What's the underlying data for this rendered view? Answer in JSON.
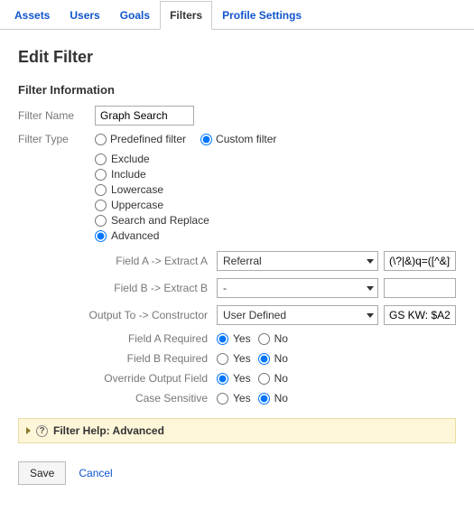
{
  "tabs": {
    "items": [
      "Assets",
      "Users",
      "Goals",
      "Filters",
      "Profile Settings"
    ],
    "active_index": 3
  },
  "page_title": "Edit Filter",
  "section_title": "Filter Information",
  "labels": {
    "filter_name": "Filter Name",
    "filter_type": "Filter Type"
  },
  "filter_name_value": "Graph Search",
  "filter_type": {
    "predefined": "Predefined filter",
    "custom": "Custom filter",
    "selected": "custom"
  },
  "custom_options": {
    "items": [
      "Exclude",
      "Include",
      "Lowercase",
      "Uppercase",
      "Search and Replace",
      "Advanced"
    ],
    "selected_index": 5
  },
  "advanced": {
    "field_a_label": "Field A -> Extract A",
    "field_a_select": "Referral",
    "field_a_value": "(\\?|&)q=([^&]*)",
    "field_b_label": "Field B -> Extract B",
    "field_b_select": "-",
    "field_b_value": "",
    "output_label": "Output To -> Constructor",
    "output_select": "User Defined",
    "output_value": "GS KW: $A2",
    "field_a_required_label": "Field A Required",
    "field_b_required_label": "Field B Required",
    "override_label": "Override Output Field",
    "case_label": "Case Sensitive",
    "yes": "Yes",
    "no": "No",
    "field_a_required": "yes",
    "field_b_required": "no",
    "override": "yes",
    "case_sensitive": "no"
  },
  "help_title": "Filter Help: Advanced",
  "actions": {
    "save": "Save",
    "cancel": "Cancel"
  }
}
